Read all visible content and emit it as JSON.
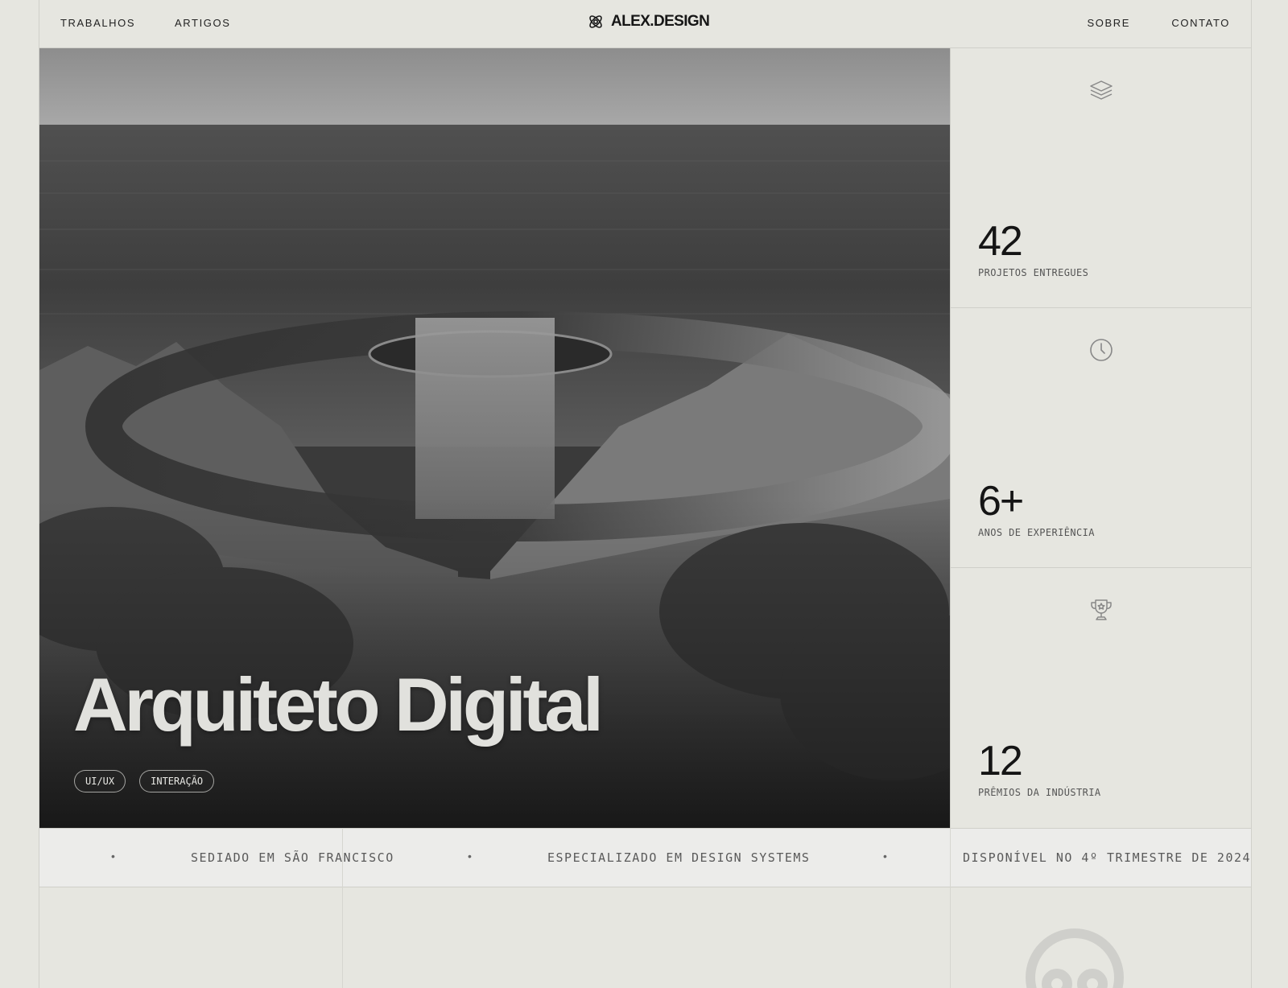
{
  "header": {
    "nav_left": [
      "TRABALHOS",
      "ARTIGOS"
    ],
    "logo_text": "ALEX.DESIGN",
    "nav_right": [
      "SOBRE",
      "CONTATO"
    ]
  },
  "hero": {
    "title": "Arquiteto Digital",
    "tags": [
      "UI/UX",
      "INTERAÇÃO"
    ]
  },
  "stats": [
    {
      "icon": "layers-icon",
      "number": "42",
      "label": "PROJETOS ENTREGUES"
    },
    {
      "icon": "clock-icon",
      "number": "6+",
      "label": "ANOS DE EXPERIÊNCIA"
    },
    {
      "icon": "trophy-icon",
      "number": "12",
      "label": "PRÊMIOS DA INDÚSTRIA"
    }
  ],
  "ticker": {
    "separator": "•",
    "items": [
      "SEDIADO EM SÃO FRANCISCO",
      "ESPECIALIZADO EM DESIGN SYSTEMS",
      "DISPONÍVEL NO 4º TRIMESTRE DE 2024"
    ]
  },
  "colors": {
    "background": "#e6e6e0",
    "ink": "#1b1b1b",
    "muted": "#555555",
    "line": "#cfcfc9"
  }
}
